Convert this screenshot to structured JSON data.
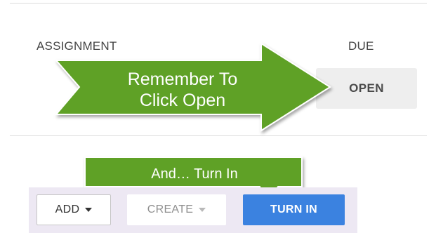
{
  "table_header": {
    "assignment_label": "ASSIGNMENT",
    "due_label": "DUE"
  },
  "open_button": {
    "label": "OPEN"
  },
  "callouts": {
    "big_arrow_line1": "Remember To",
    "big_arrow_line2": "Click Open",
    "small_arrow_text": "And… Turn In",
    "color": "#5ea125"
  },
  "toolbar": {
    "add_label": "ADD",
    "create_label": "CREATE",
    "turnin_label": "TURN IN",
    "turnin_color": "#3b82e0"
  }
}
